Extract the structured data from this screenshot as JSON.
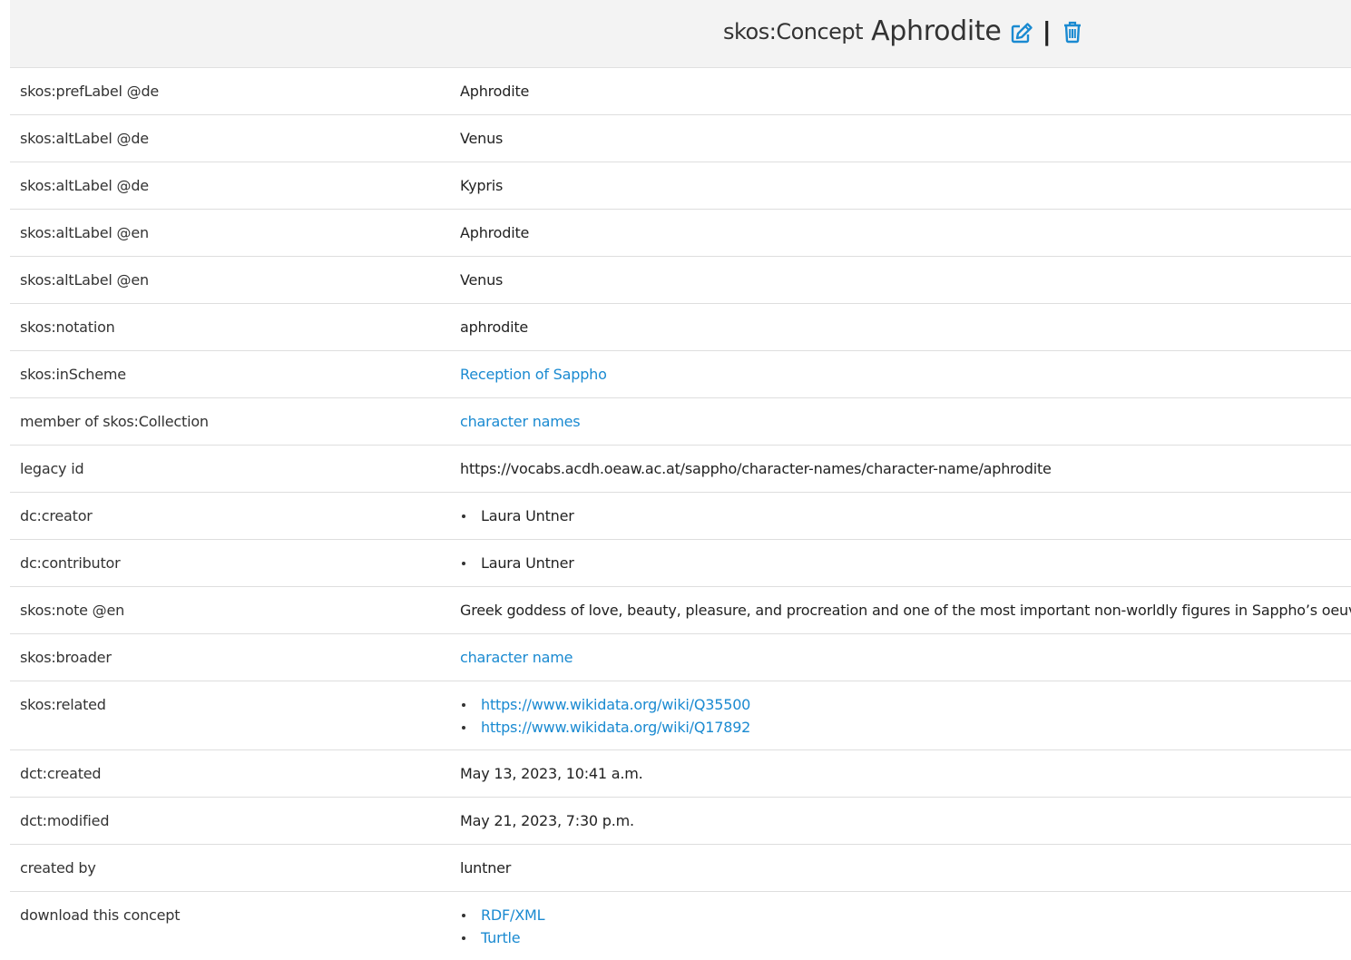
{
  "header": {
    "kind": "skos:Concept",
    "title": "Aphrodite",
    "separator": "|",
    "accent_color": "#1a8ad1",
    "edit_icon": "edit-icon",
    "delete_icon": "trash-icon"
  },
  "rows": {
    "pref_label_de": {
      "key": "skos:prefLabel @de",
      "value": "Aphrodite"
    },
    "alt_label_de_1": {
      "key": "skos:altLabel @de",
      "value": "Venus"
    },
    "alt_label_de_2": {
      "key": "skos:altLabel @de",
      "value": "Kypris"
    },
    "alt_label_en_1": {
      "key": "skos:altLabel @en",
      "value": "Aphrodite"
    },
    "alt_label_en_2": {
      "key": "skos:altLabel @en",
      "value": "Venus"
    },
    "notation": {
      "key": "skos:notation",
      "value": "aphrodite"
    },
    "in_scheme": {
      "key": "skos:inScheme",
      "value": "Reception of Sappho"
    },
    "collection": {
      "key": "member of skos:Collection",
      "value": "character names"
    },
    "legacy_id": {
      "key": "legacy id",
      "value": "https://vocabs.acdh.oeaw.ac.at/sappho/character-names/character-name/aphrodite"
    },
    "creator": {
      "key": "dc:creator",
      "items": [
        "Laura Untner"
      ]
    },
    "contributor": {
      "key": "dc:contributor",
      "items": [
        "Laura Untner"
      ]
    },
    "note_en": {
      "key": "skos:note @en",
      "value": "Greek goddess of love, beauty, pleasure, and procreation and one of the most important non-worldly figures in Sappho’s oeuvre."
    },
    "broader": {
      "key": "skos:broader",
      "value": "character name"
    },
    "related": {
      "key": "skos:related",
      "items": [
        "https://www.wikidata.org/wiki/Q35500",
        "https://www.wikidata.org/wiki/Q17892"
      ]
    },
    "created": {
      "key": "dct:created",
      "value": "May 13, 2023, 10:41 a.m."
    },
    "modified": {
      "key": "dct:modified",
      "value": "May 21, 2023, 7:30 p.m."
    },
    "created_by": {
      "key": "created by",
      "value": "luntner"
    },
    "download": {
      "key": "download this concept",
      "items": [
        "RDF/XML",
        "Turtle"
      ]
    }
  }
}
